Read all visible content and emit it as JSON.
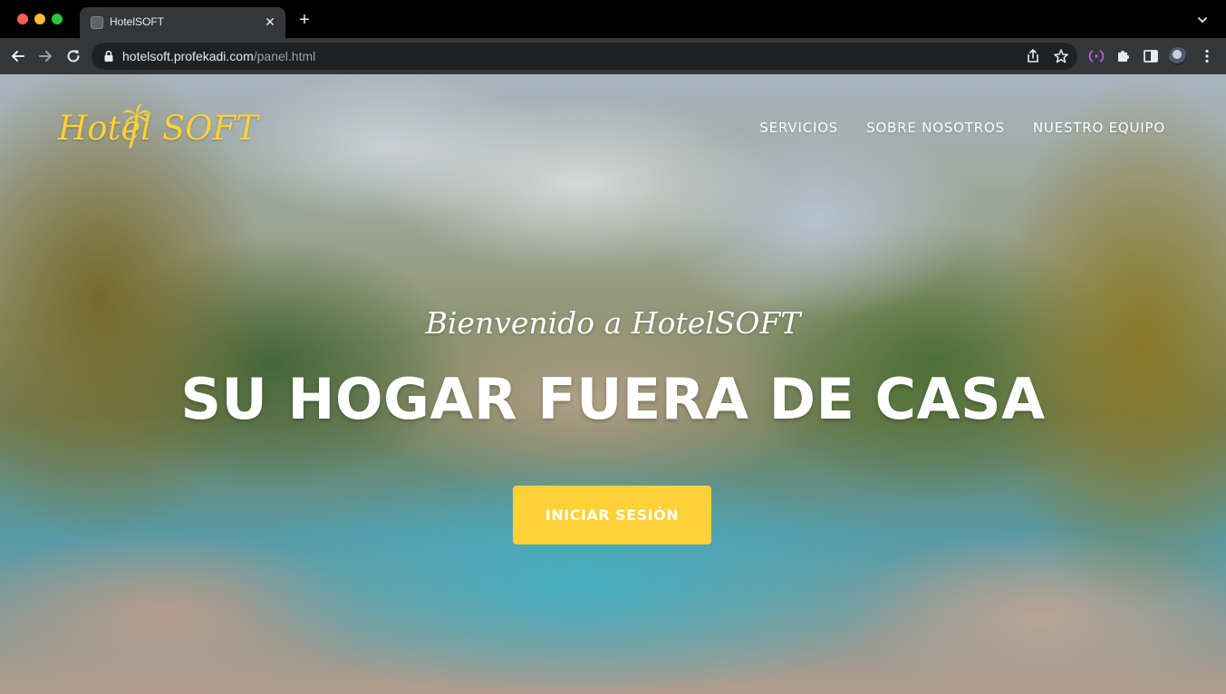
{
  "browser": {
    "tab_title": "HotelSOFT",
    "tab_close": "✕",
    "new_tab": "+",
    "url_host": "hotelsoft.profekadi.com",
    "url_path": "/panel.html"
  },
  "page": {
    "logo_text": "Hotel SOFT",
    "logo_color": "#fed136",
    "nav": [
      "SERVICIOS",
      "SOBRE NOSOTROS",
      "NUESTRO EQUIPO"
    ],
    "subtitle": "Bienvenido a HotelSOFT",
    "headline": "SU HOGAR FUERA DE CASA",
    "cta_label": "INICIAR SESIÓN",
    "accent_color": "#fed136"
  },
  "icons": {
    "tab_favicon": "favicon-icon",
    "back": "back-arrow-icon",
    "forward": "forward-arrow-icon",
    "reload": "reload-icon",
    "lock": "lock-icon",
    "share": "share-icon",
    "bookmark": "star-icon",
    "extension_tunnel": "tunnel-extension-icon",
    "extensions": "puzzle-icon",
    "side_panel": "side-panel-icon",
    "profile": "avatar",
    "menu": "kebab-menu-icon"
  }
}
